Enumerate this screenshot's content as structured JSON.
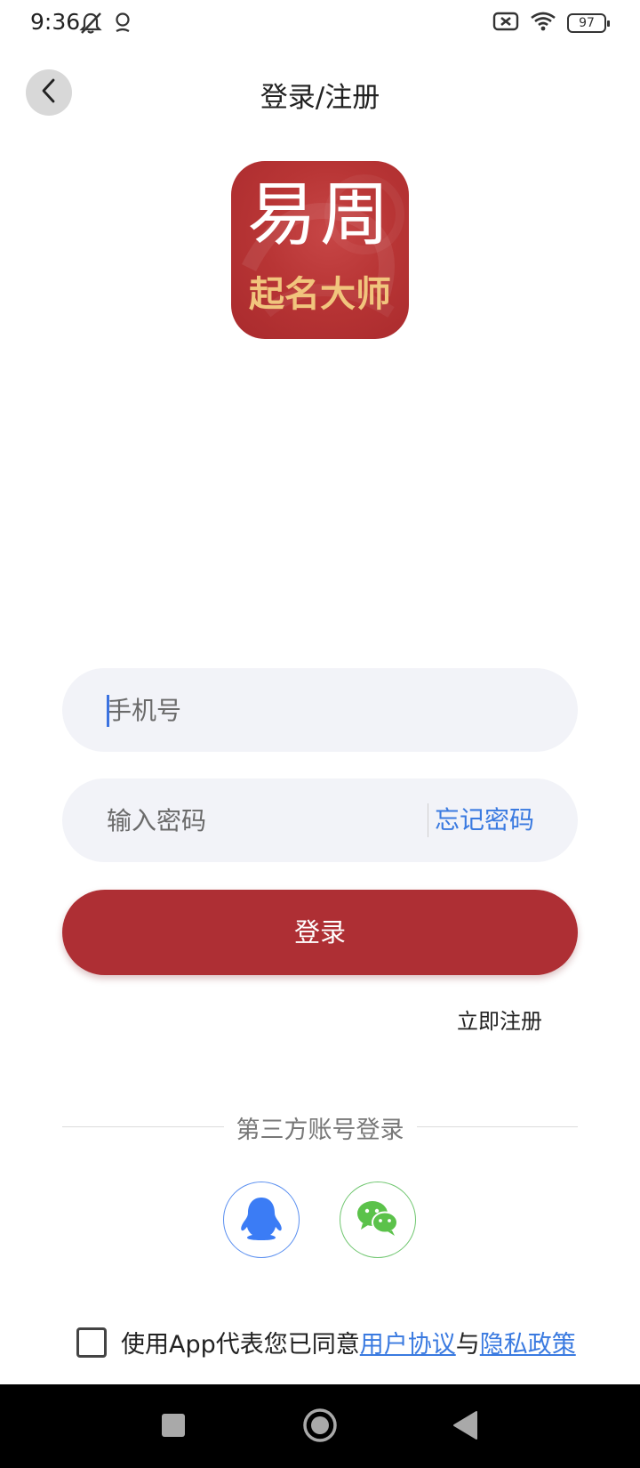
{
  "status_bar": {
    "time": "9:36",
    "battery": "97",
    "left_icons": [
      "notifications-off-icon",
      "location-pin-icon"
    ],
    "right_icons": [
      "sim-off-icon",
      "wifi-icon",
      "battery-icon"
    ]
  },
  "header": {
    "title": "登录/注册",
    "back_icon": "chevron-left-icon"
  },
  "logo": {
    "big_text": "易周",
    "small_text": "起名大师"
  },
  "form": {
    "phone_placeholder": "手机号",
    "phone_value": "",
    "password_placeholder": "输入密码",
    "password_value": "",
    "forgot_label": "忘记密码",
    "login_label": "登录",
    "register_label": "立即注册"
  },
  "third_party": {
    "label": "第三方账号登录",
    "providers": [
      {
        "name": "QQ",
        "icon": "qq-penguin-icon",
        "color": "#3b7cf5"
      },
      {
        "name": "WeChat",
        "icon": "wechat-icon",
        "color": "#5bc24a"
      }
    ]
  },
  "agreement": {
    "checked": false,
    "prefix": "使用App代表您已同意",
    "terms_label": "用户协议",
    "joiner": "与",
    "privacy_label": "隐私政策"
  },
  "colors": {
    "primary": "#ae2f34",
    "link": "#3a7ae0",
    "input_bg": "#f2f3f8"
  },
  "nav_bar": {
    "icons": [
      "recents-square-icon",
      "home-circle-icon",
      "back-triangle-icon"
    ]
  }
}
